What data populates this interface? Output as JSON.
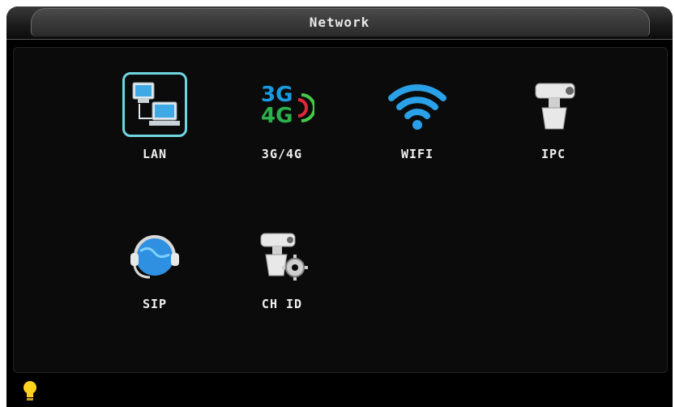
{
  "window": {
    "title": "Network"
  },
  "menu": {
    "items": [
      {
        "id": "lan",
        "label": "LAN",
        "icon": "lan-computers-icon",
        "selected": true
      },
      {
        "id": "cellular",
        "label": "3G/4G",
        "icon": "3g-4g-signal-icon",
        "selected": false
      },
      {
        "id": "wifi",
        "label": "WIFI",
        "icon": "wifi-icon",
        "selected": false
      },
      {
        "id": "ipc",
        "label": "IPC",
        "icon": "ip-camera-icon",
        "selected": false
      },
      {
        "id": "sip",
        "label": "SIP",
        "icon": "globe-headset-icon",
        "selected": false
      },
      {
        "id": "chid",
        "label": "CH ID",
        "icon": "camera-gear-icon",
        "selected": false
      }
    ]
  },
  "cellular_icon_text": {
    "line1": "3G",
    "line2": "4G"
  },
  "status": {
    "icon": "lightbulb-icon"
  },
  "colors": {
    "selection_border": "#6fd6e0",
    "wifi_blue": "#2aa0e8",
    "cell_3g": "#1a9ae0",
    "cell_4g": "#2bb24a",
    "signal_red": "#e0283a",
    "signal_green": "#46c84a",
    "bulb": "#ffd21f"
  }
}
